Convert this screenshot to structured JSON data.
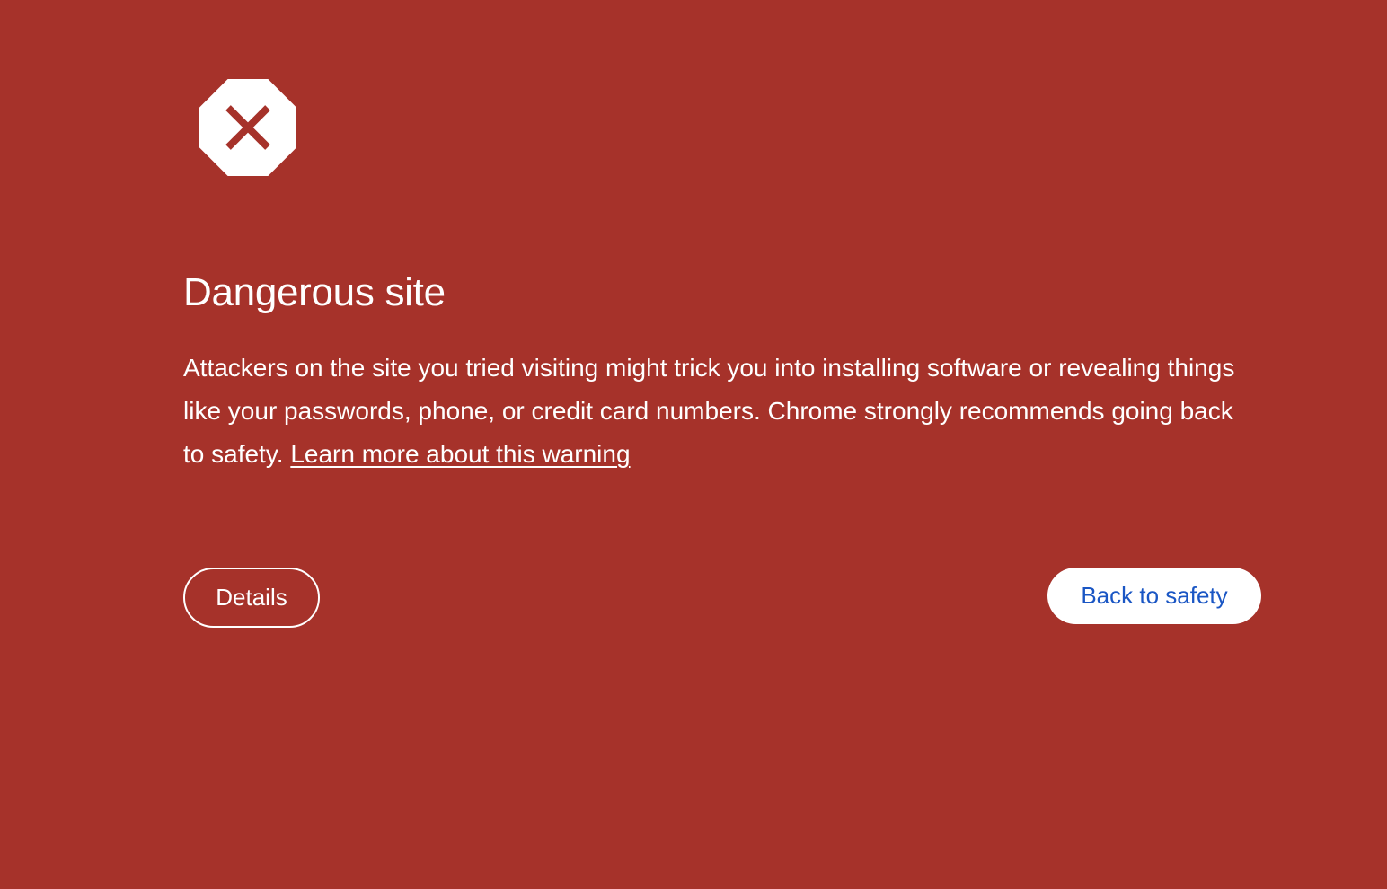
{
  "page": {
    "background_color": "#a6322a",
    "accent_color": "#1a56c4"
  },
  "icon": {
    "name": "stop-octagon-x-icon"
  },
  "heading": "Dangerous site",
  "body": {
    "text": "Attackers on the site you tried visiting might trick you into installing software or revealing things like your passwords, phone, or credit card numbers. Chrome strongly recommends going back to safety. ",
    "link_text": "Learn more about this warning"
  },
  "buttons": {
    "details_label": "Details",
    "back_label": "Back to safety"
  }
}
